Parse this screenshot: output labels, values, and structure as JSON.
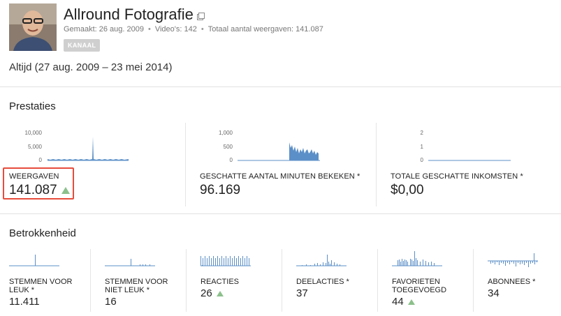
{
  "channel": {
    "name": "Allround Fotografie",
    "created": "Gemaakt: 26 aug. 2009",
    "videos": "Video's: 142",
    "total_views": "Totaal aantal weergaven: 141.087",
    "badge": "KANAAL",
    "date_range": "Altijd (27 aug. 2009 – 23 mei 2014)"
  },
  "performance": {
    "title": "Prestaties",
    "metrics": [
      {
        "label": "WEERGAVEN",
        "value": "141.087",
        "trend": "up",
        "ticks": [
          "10,000",
          "5,000",
          "0"
        ]
      },
      {
        "label": "GESCHATTE AANTAL MINUTEN BEKEKEN *",
        "value": "96.169",
        "ticks": [
          "1,000",
          "500",
          "0"
        ]
      },
      {
        "label": "TOTALE GESCHATTE INKOMSTEN *",
        "value": "$0,00",
        "ticks": [
          "2",
          "1",
          "0"
        ]
      }
    ]
  },
  "engagement": {
    "title": "Betrokkenheid",
    "metrics": [
      {
        "label_line1": "STEMMEN VOOR",
        "label_line2": "LEUK *",
        "value": "11.411",
        "trend": ""
      },
      {
        "label_line1": "STEMMEN VOOR",
        "label_line2": "NIET LEUK *",
        "value": "16",
        "trend": ""
      },
      {
        "label_line1": "REACTIES",
        "label_line2": "",
        "value": "26",
        "trend": "up"
      },
      {
        "label_line1": "DEELACTIES *",
        "label_line2": "",
        "value": "37",
        "trend": ""
      },
      {
        "label_line1": "FAVORIETEN",
        "label_line2": "TOEGEVOEGD",
        "value": "44",
        "trend": "up"
      },
      {
        "label_line1": "ABONNEES *",
        "label_line2": "",
        "value": "34",
        "trend": ""
      }
    ]
  },
  "colors": {
    "spark": "#5b8fc7",
    "trend_up": "#8cc08c",
    "highlight": "#e74c3c"
  },
  "icons": {
    "external": "external-link-icon",
    "trend": "triangle-up-icon"
  }
}
